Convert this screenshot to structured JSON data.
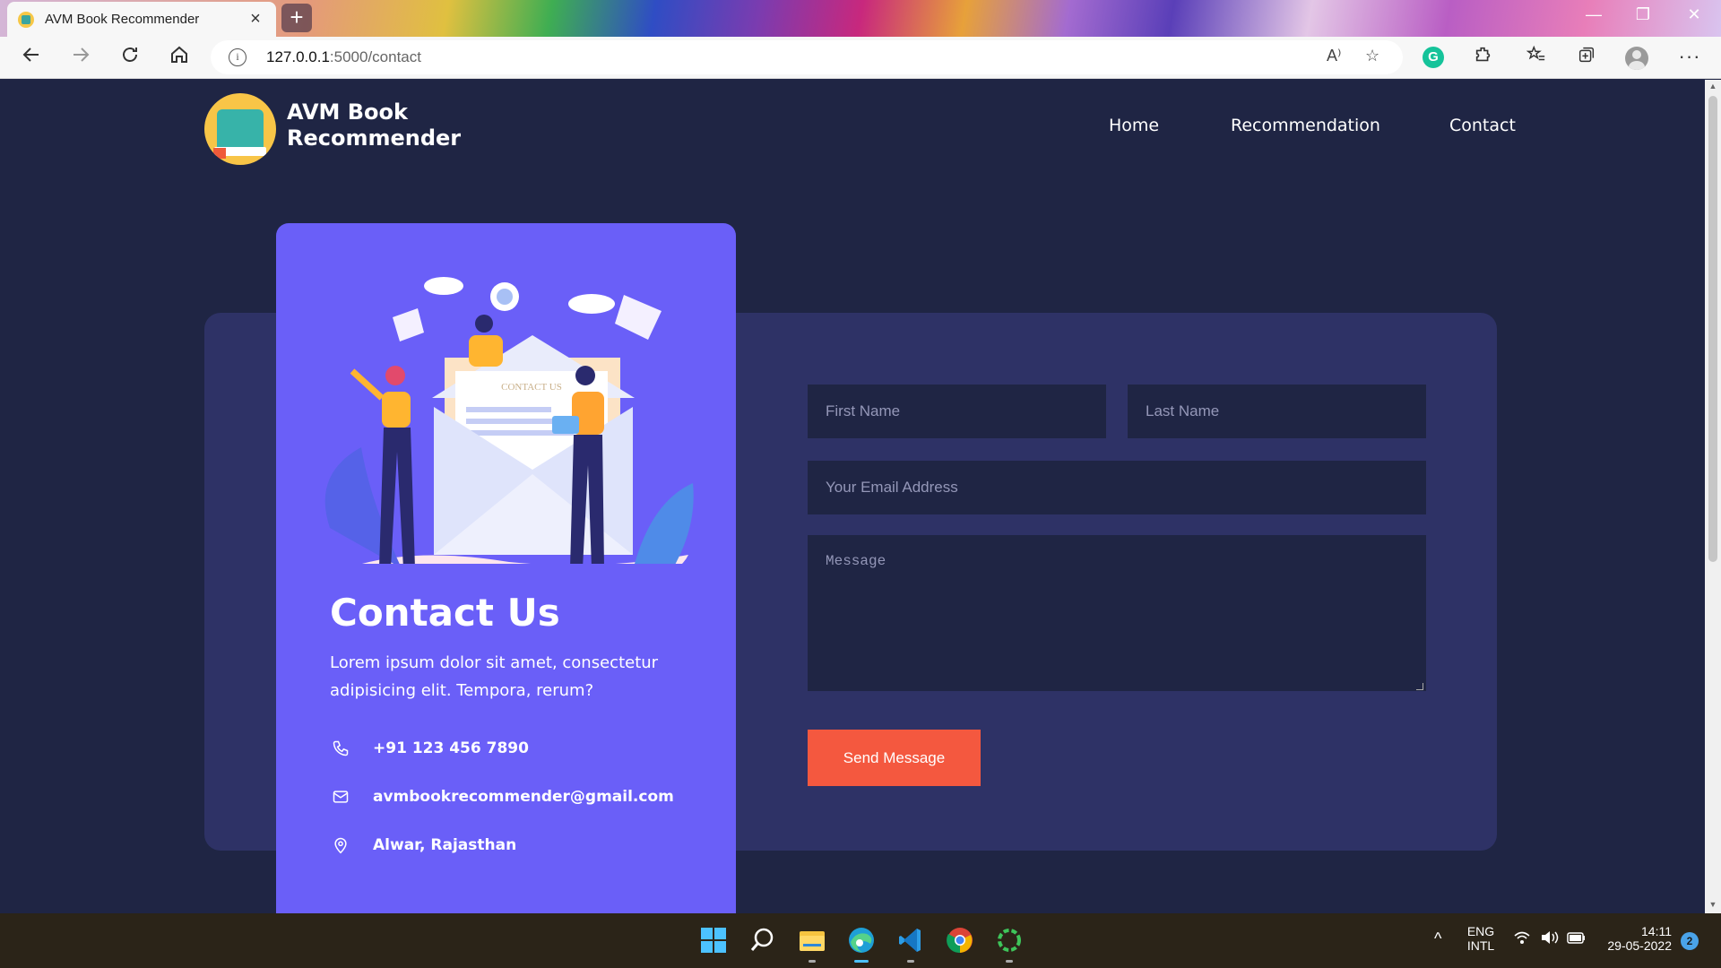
{
  "browser": {
    "tab_title": "AVM Book Recommender",
    "url_host": "127.0.0.1",
    "url_path": ":5000/contact"
  },
  "site": {
    "name": "AVM Book Recommender",
    "nav": [
      "Home",
      "Recommendation",
      "Contact"
    ]
  },
  "contact": {
    "illustration_label": "CONTACT US",
    "title": "Contact Us",
    "description": "Lorem ipsum dolor sit amet, consectetur adipisicing elit. Tempora, rerum?",
    "phone": "+91 123 456 7890",
    "email": "avmbookrecommender@gmail.com",
    "address": "Alwar, Rajasthan"
  },
  "form": {
    "first_name_placeholder": "First Name",
    "last_name_placeholder": "Last Name",
    "email_placeholder": "Your Email Address",
    "message_placeholder": "Message",
    "submit_label": "Send Message"
  },
  "taskbar": {
    "lang": "ENG",
    "layout": "INTL",
    "time": "14:11",
    "date": "29-05-2022",
    "notifications": "2"
  },
  "colors": {
    "page_bg": "#1f2544",
    "panel_bg": "#2e3266",
    "card_bg": "#6a5ff8",
    "button_bg": "#f4583f"
  }
}
